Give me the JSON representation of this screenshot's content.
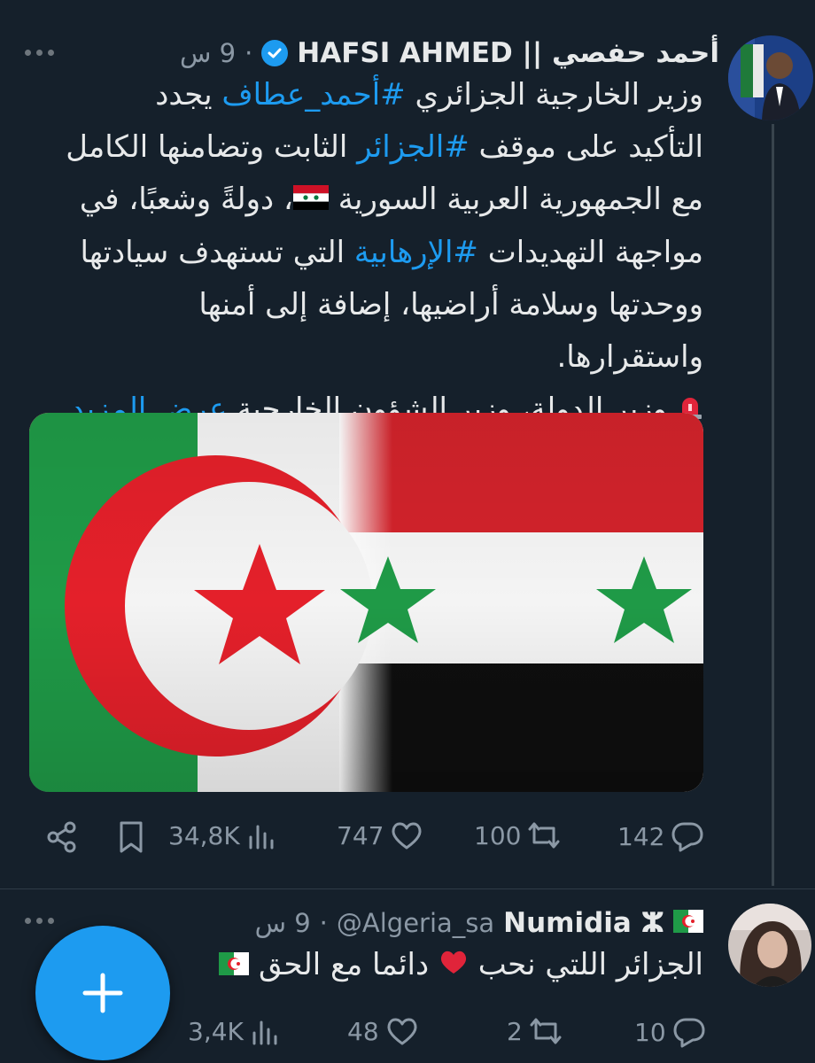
{
  "tweet1": {
    "display_name": "أحمد حفصي || HAFSI AHMED",
    "dot": "·",
    "time": "9 س",
    "text": {
      "l1a": "وزير الخارجية الجزائري ",
      "l1tag": "#أحمد_عطاف",
      "l1b": " يجدد",
      "l2a": "التأكيد على موقف ",
      "l2tag": "#الجزائر",
      "l2b": " الثابت وتضامنها الكامل",
      "l3a": "مع الجمهورية العربية السورية ",
      "l3b": "، دولةً وشعبًا، في",
      "l4a": "مواجهة التهديدات ",
      "l4tag": "#الإرهابية",
      "l4b": " التي تستهدف سيادتها",
      "l5": "ووحدتها وسلامة أراضيها، إضافة إلى أمنها",
      "l6": "واستقرارها.",
      "l7": " وزير الدولة، وزير الشؤون الخارجية ",
      "see_more": "عرض المزيد"
    },
    "stats": {
      "views": "34,8K",
      "likes": "747",
      "retweets": "100",
      "replies": "142"
    }
  },
  "tweet2": {
    "display_name": "Numidia ⵣ",
    "handle": "@Algeria_sa",
    "dot": "·",
    "time": "9 س",
    "text_a": "الجزائر اللتي نحب ",
    "text_b": " دائما مع الحق ",
    "stats": {
      "views": "3,4K",
      "likes": "48",
      "retweets": "2",
      "replies": "10"
    }
  },
  "icons": {
    "share": "share-icon",
    "bookmark": "bookmark-icon",
    "views": "views-icon",
    "like": "heart-icon",
    "retweet": "retweet-icon",
    "reply": "reply-icon",
    "compose": "plus-icon"
  },
  "colors": {
    "background": "#15202b",
    "accent": "#1d9bf0",
    "muted": "#8b98a5"
  }
}
